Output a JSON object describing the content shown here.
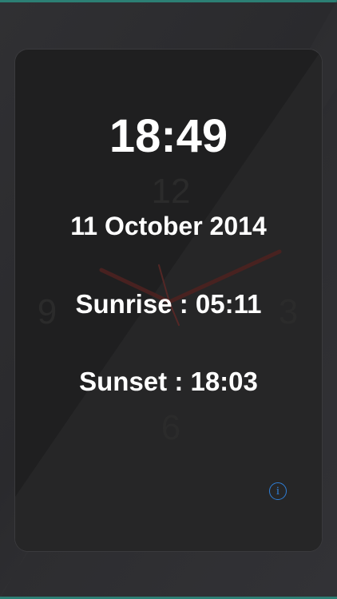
{
  "clock": {
    "time": "18:49",
    "date": "11 October 2014",
    "sunrise": "Sunrise : 05:11",
    "sunset": "Sunset : 18:03"
  },
  "dial": {
    "numeral_12": "12",
    "numeral_3": "3",
    "numeral_6": "6",
    "numeral_9": "9"
  },
  "info": {
    "icon_name": "info-icon",
    "glyph": "i"
  },
  "colors": {
    "accent": "#2c7f74",
    "info": "#2f7fd8",
    "hand": "#5a2422"
  }
}
